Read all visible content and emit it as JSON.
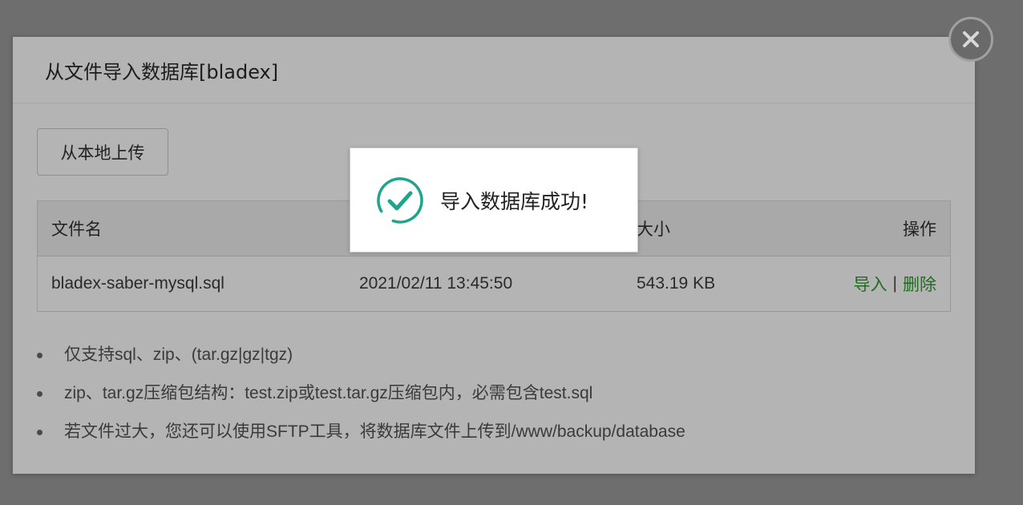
{
  "dialog": {
    "title": "从文件导入数据库[bladex]",
    "close_icon": "close-icon"
  },
  "upload_button": {
    "label": "从本地上传"
  },
  "table": {
    "headers": {
      "name": "文件名",
      "time": "",
      "size": "大小",
      "actions": "操作"
    },
    "rows": [
      {
        "name": "bladex-saber-mysql.sql",
        "time": "2021/02/11 13:45:50",
        "size": "543.19 KB",
        "import_label": "导入",
        "separator": "|",
        "delete_label": "删除"
      }
    ]
  },
  "notes": [
    "仅支持sql、zip、(tar.gz|gz|tgz)",
    "zip、tar.gz压缩包结构：test.zip或test.tar.gz压缩包内，必需包含test.sql",
    "若文件过大，您还可以使用SFTP工具，将数据库文件上传到/www/backup/database"
  ],
  "toast": {
    "icon": "success-check-icon",
    "message": "导入数据库成功!"
  },
  "colors": {
    "overlay": "#6e6e6e",
    "dialog_bg": "#b4b4b4",
    "link_green": "#1e6e1e",
    "success_teal": "#20a58a"
  }
}
